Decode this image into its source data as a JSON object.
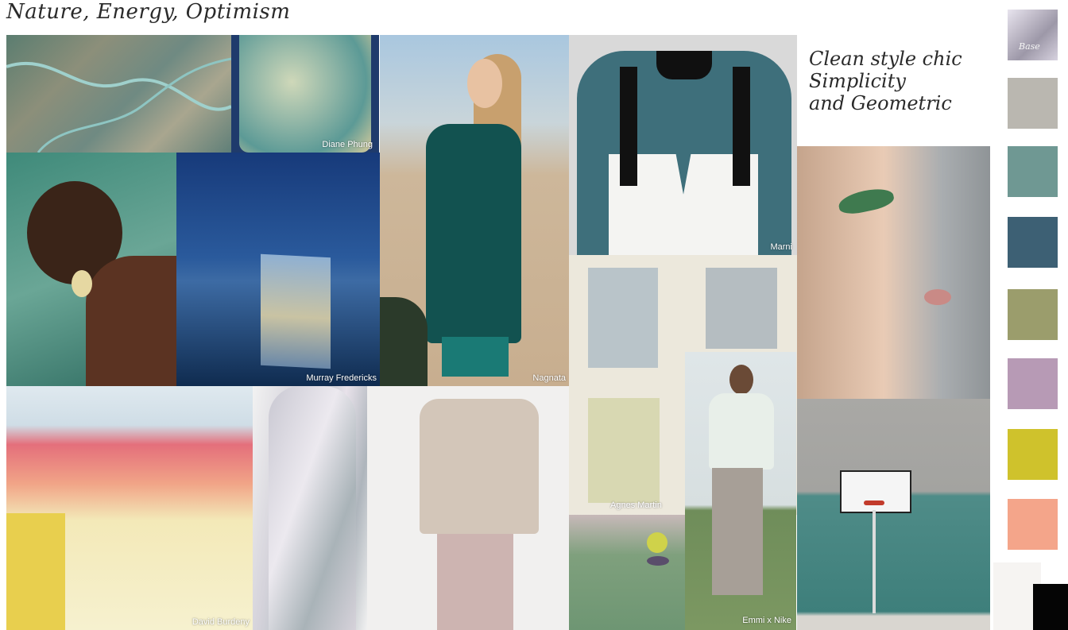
{
  "board": {
    "title": "Nature, Energy, Optimism",
    "subtitle_lines": [
      "Clean style chic",
      "Simplicity",
      "and Geometric"
    ],
    "swatch_label": "Base"
  },
  "captions": {
    "fabric": "Diane Phung",
    "horizon": "Murray Fredericks",
    "desert": "Nagnata",
    "apron": "Marni",
    "paint": "Agnes Martin",
    "skirt": "Emmi x Nike",
    "salt": "David Burdeny"
  },
  "palette": [
    {
      "name": "swatch-silver-gradient",
      "color": "#b9b6c2"
    },
    {
      "name": "swatch-grey",
      "color": "#bab7b0"
    },
    {
      "name": "swatch-teal-grey",
      "color": "#6f9893"
    },
    {
      "name": "swatch-dark-teal",
      "color": "#3d6074"
    },
    {
      "name": "swatch-olive",
      "color": "#9b9d6c"
    },
    {
      "name": "swatch-lilac",
      "color": "#b79ab5"
    },
    {
      "name": "swatch-chartreuse",
      "color": "#cfc22c"
    },
    {
      "name": "swatch-coral",
      "color": "#f4a58a"
    }
  ]
}
